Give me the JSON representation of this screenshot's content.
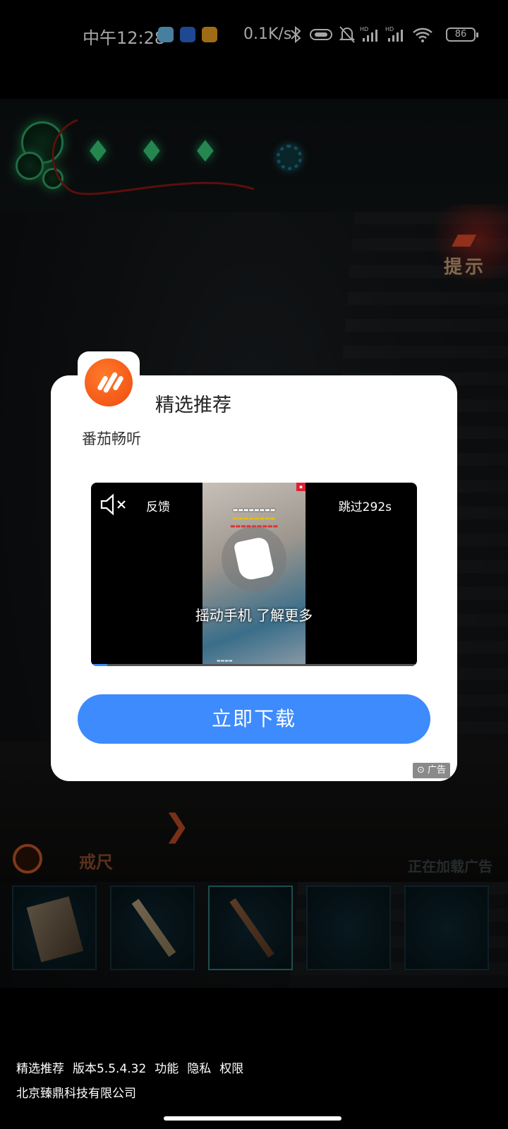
{
  "status_bar": {
    "time": "中午12:28",
    "net_speed": "0.1K/s",
    "battery": "86"
  },
  "game": {
    "hint_label": "提示",
    "item_label": "戒尺",
    "loading_ad_text": "正在加载广告"
  },
  "dialog": {
    "title": "精选推荐",
    "app_name": "番茄畅听",
    "video": {
      "feedback_label": "反馈",
      "skip_label": "跳过292s",
      "shake_text": "摇动手机 了解更多",
      "progress_fraction": 0.05
    },
    "download_button": "立即下载",
    "ad_badge": "广告"
  },
  "footer": {
    "links": [
      "精选推荐",
      "版本5.5.4.32",
      "功能",
      "隐私",
      "权限"
    ],
    "company": "北京臻鼎科技有限公司"
  },
  "colors": {
    "accent": "#3d8bfd",
    "logo": "#f04a10"
  }
}
